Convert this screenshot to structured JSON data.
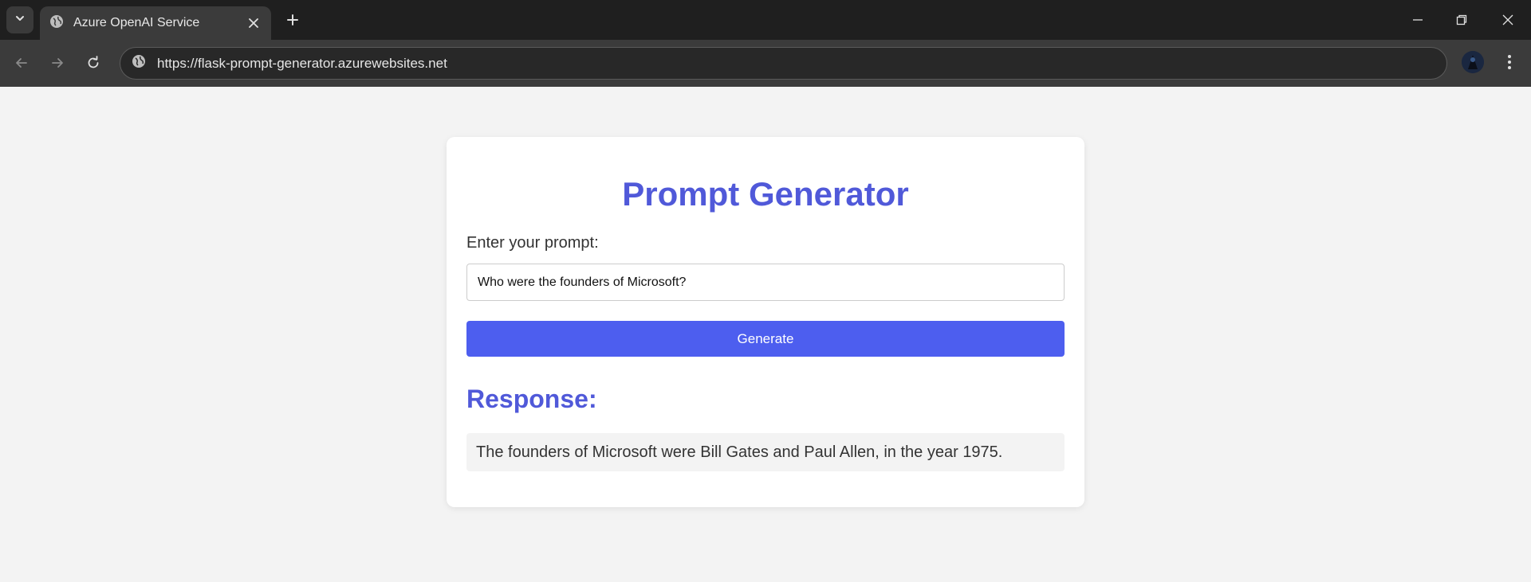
{
  "browser": {
    "tab_title": "Azure OpenAI Service",
    "url": "https://flask-prompt-generator.azurewebsites.net",
    "icons": {
      "tab_search": "chevron-down-icon",
      "tab_favicon": "globe-icon",
      "tab_close": "close-icon",
      "new_tab": "plus-icon",
      "minimize": "minimize-icon",
      "restore": "restore-icon",
      "close_window": "close-icon",
      "back": "arrow-left-icon",
      "forward": "arrow-right-icon",
      "reload": "reload-icon",
      "site_info": "globe-icon",
      "menu": "more-vertical-icon"
    }
  },
  "page": {
    "title": "Prompt Generator",
    "prompt_label": "Enter your prompt:",
    "prompt_value": "Who were the founders of Microsoft?",
    "generate_label": "Generate",
    "response_heading": "Response:",
    "response_text": "The founders of Microsoft were Bill Gates and Paul Allen, in the year 1975."
  },
  "colors": {
    "accent": "#5059d9",
    "button": "#4d5eef",
    "page_bg": "#f3f3f3",
    "card_bg": "#ffffff",
    "chrome_dark": "#1f1f1f",
    "chrome_toolbar": "#3b3b3b"
  }
}
